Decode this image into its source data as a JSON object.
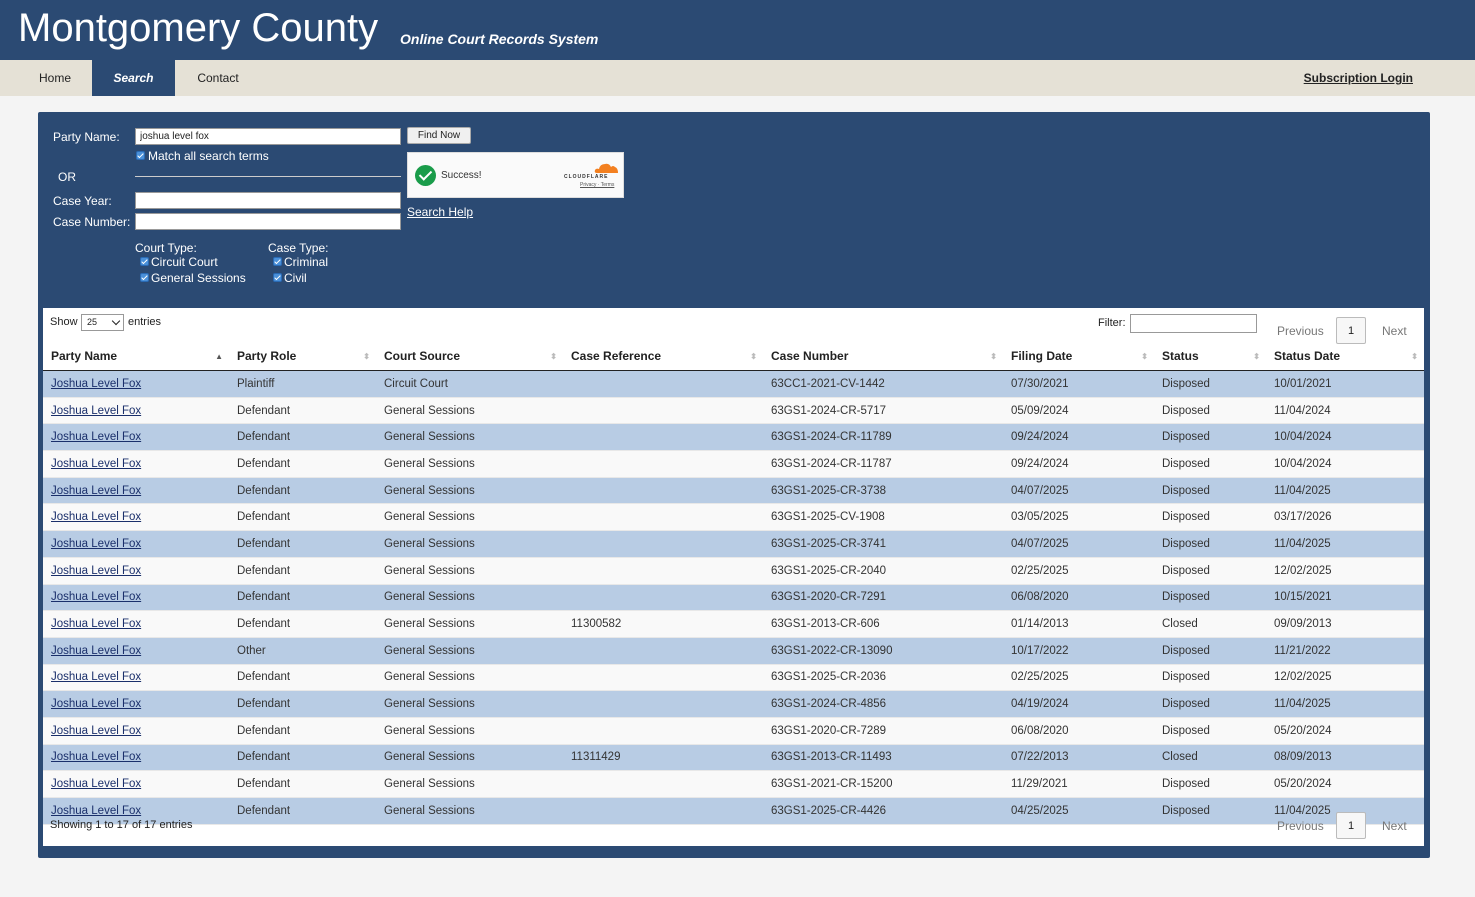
{
  "header": {
    "title": "Montgomery County",
    "subtitle": "Online Court Records System"
  },
  "nav": {
    "items": [
      "Home",
      "Search",
      "Contact"
    ],
    "active": "Search",
    "login": "Subscription Login"
  },
  "search": {
    "party_name_label": "Party Name:",
    "party_name_value": "joshua level fox",
    "find_button": "Find Now",
    "match_all_label": "Match all search terms",
    "or_label": "OR",
    "case_year_label": "Case Year:",
    "case_number_label": "Case Number:",
    "court_type_label": "Court Type:",
    "court_types": [
      "Circuit Court",
      "General Sessions"
    ],
    "case_type_label": "Case Type:",
    "case_types": [
      "Criminal",
      "Civil"
    ],
    "help_link": "Search Help"
  },
  "captcha": {
    "status_text": "Success!",
    "provider": "CLOUDFLARE",
    "links": "Privacy · Terms"
  },
  "results": {
    "show_label": "Show",
    "page_size": "25",
    "entries_label": "entries",
    "filter_label": "Filter:",
    "previous": "Previous",
    "next": "Next",
    "page": "1",
    "showing_text": "Showing 1 to 17 of 17 entries",
    "columns": [
      "Party Name",
      "Party Role",
      "Court Source",
      "Case Reference",
      "Case Number",
      "Filing Date",
      "Status",
      "Status Date"
    ],
    "rows": [
      [
        "Joshua Level Fox",
        "Plaintiff",
        "Circuit Court",
        "",
        "63CC1-2021-CV-1442",
        "07/30/2021",
        "Disposed",
        "10/01/2021"
      ],
      [
        "Joshua Level Fox",
        "Defendant",
        "General Sessions",
        "",
        "63GS1-2024-CR-5717",
        "05/09/2024",
        "Disposed",
        "11/04/2024"
      ],
      [
        "Joshua Level Fox",
        "Defendant",
        "General Sessions",
        "",
        "63GS1-2024-CR-11789",
        "09/24/2024",
        "Disposed",
        "10/04/2024"
      ],
      [
        "Joshua Level Fox",
        "Defendant",
        "General Sessions",
        "",
        "63GS1-2024-CR-11787",
        "09/24/2024",
        "Disposed",
        "10/04/2024"
      ],
      [
        "Joshua Level Fox",
        "Defendant",
        "General Sessions",
        "",
        "63GS1-2025-CR-3738",
        "04/07/2025",
        "Disposed",
        "11/04/2025"
      ],
      [
        "Joshua Level Fox",
        "Defendant",
        "General Sessions",
        "",
        "63GS1-2025-CV-1908",
        "03/05/2025",
        "Disposed",
        "03/17/2026"
      ],
      [
        "Joshua Level Fox",
        "Defendant",
        "General Sessions",
        "",
        "63GS1-2025-CR-3741",
        "04/07/2025",
        "Disposed",
        "11/04/2025"
      ],
      [
        "Joshua Level Fox",
        "Defendant",
        "General Sessions",
        "",
        "63GS1-2025-CR-2040",
        "02/25/2025",
        "Disposed",
        "12/02/2025"
      ],
      [
        "Joshua Level Fox",
        "Defendant",
        "General Sessions",
        "",
        "63GS1-2020-CR-7291",
        "06/08/2020",
        "Disposed",
        "10/15/2021"
      ],
      [
        "Joshua Level Fox",
        "Defendant",
        "General Sessions",
        "11300582",
        "63GS1-2013-CR-606",
        "01/14/2013",
        "Closed",
        "09/09/2013"
      ],
      [
        "Joshua Level Fox",
        "Other",
        "General Sessions",
        "",
        "63GS1-2022-CR-13090",
        "10/17/2022",
        "Disposed",
        "11/21/2022"
      ],
      [
        "Joshua Level Fox",
        "Defendant",
        "General Sessions",
        "",
        "63GS1-2025-CR-2036",
        "02/25/2025",
        "Disposed",
        "12/02/2025"
      ],
      [
        "Joshua Level Fox",
        "Defendant",
        "General Sessions",
        "",
        "63GS1-2024-CR-4856",
        "04/19/2024",
        "Disposed",
        "11/04/2025"
      ],
      [
        "Joshua Level Fox",
        "Defendant",
        "General Sessions",
        "",
        "63GS1-2020-CR-7289",
        "06/08/2020",
        "Disposed",
        "05/20/2024"
      ],
      [
        "Joshua Level Fox",
        "Defendant",
        "General Sessions",
        "11311429",
        "63GS1-2013-CR-11493",
        "07/22/2013",
        "Closed",
        "08/09/2013"
      ],
      [
        "Joshua Level Fox",
        "Defendant",
        "General Sessions",
        "",
        "63GS1-2021-CR-15200",
        "11/29/2021",
        "Disposed",
        "05/20/2024"
      ],
      [
        "Joshua Level Fox",
        "Defendant",
        "General Sessions",
        "",
        "63GS1-2025-CR-4426",
        "04/25/2025",
        "Disposed",
        "11/04/2025"
      ]
    ]
  },
  "colors": {
    "header_bg": "#2b4a73",
    "nav_bg": "#e5e1d6",
    "row_odd": "#b8cce4",
    "row_even": "#f9f9f9"
  }
}
